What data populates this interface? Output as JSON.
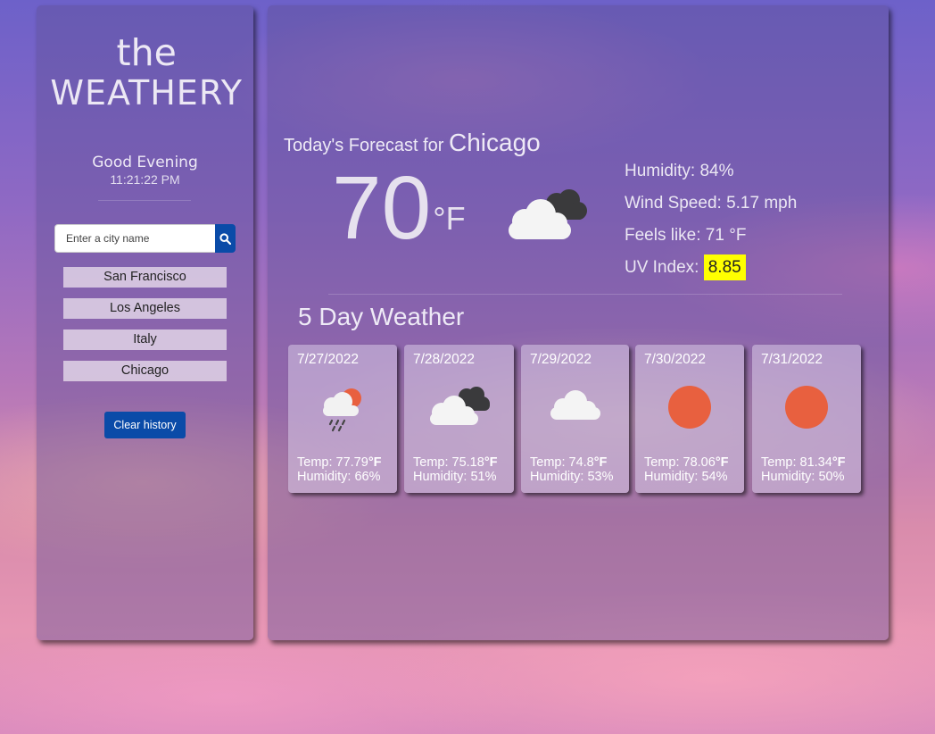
{
  "app": {
    "logo_line1": "the",
    "logo_line2": "WEATHERY"
  },
  "sidebar": {
    "greeting": "Good Evening",
    "time": "11:21:22 PM",
    "search_placeholder": "Enter a city name",
    "history": [
      "San Francisco",
      "Los Angeles",
      "Italy",
      "Chicago"
    ],
    "clear_label": "Clear history"
  },
  "today": {
    "lead": "Today's Forecast for ",
    "city": "Chicago",
    "temp": "70",
    "unit": "°F",
    "icon": "partly-cloudy-dark-icon",
    "humidity": "Humidity: 84%",
    "wind": "Wind Speed: 5.17 mph",
    "feels": "Feels like: 71 °F",
    "uv_label": "UV Index: ",
    "uv_value": "8.85",
    "uv_color": "#ffff00"
  },
  "forecast": {
    "title": "5 Day Weather",
    "days": [
      {
        "date": "7/27/2022",
        "icon": "rain-sun-cloud-icon",
        "temp_prefix": "Temp: 77.79",
        "unit": "°F",
        "humidity": "Humidity: 66%"
      },
      {
        "date": "7/28/2022",
        "icon": "dark-clouds-icon",
        "temp_prefix": "Temp: 75.18",
        "unit": "°F",
        "humidity": "Humidity: 51%"
      },
      {
        "date": "7/29/2022",
        "icon": "cloud-icon",
        "temp_prefix": "Temp: 74.8",
        "unit": "°F",
        "humidity": "Humidity: 53%"
      },
      {
        "date": "7/30/2022",
        "icon": "sun-icon",
        "temp_prefix": "Temp: 78.06",
        "unit": "°F",
        "humidity": "Humidity: 54%"
      },
      {
        "date": "7/31/2022",
        "icon": "sun-icon",
        "temp_prefix": "Temp: 81.34",
        "unit": "°F",
        "humidity": "Humidity: 50%"
      }
    ]
  },
  "colors": {
    "accent_blue": "#0a4ba8",
    "sun": "#e8603f"
  }
}
